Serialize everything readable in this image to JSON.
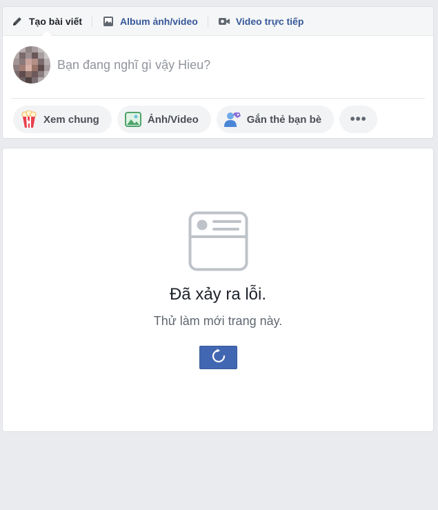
{
  "composer": {
    "tabs": [
      {
        "label": "Tạo bài viết",
        "icon": "pencil-icon"
      },
      {
        "label": "Album ảnh/video",
        "icon": "photo-album-icon"
      },
      {
        "label": "Video trực tiếp",
        "icon": "video-camera-icon"
      }
    ],
    "placeholder": "Bạn đang nghĩ gì vậy Hieu?",
    "actions": [
      {
        "label": "Xem chung",
        "icon": "popcorn-icon"
      },
      {
        "label": "Ảnh/Video",
        "icon": "photo-icon"
      },
      {
        "label": "Gắn thẻ bạn bè",
        "icon": "tag-friends-icon"
      },
      {
        "label": "•••",
        "icon": "more-icon"
      }
    ]
  },
  "error": {
    "title": "Đã xảy ra lỗi.",
    "subtitle": "Thử làm mới trang này.",
    "icon": "news-feed-placeholder-icon",
    "button_icon": "refresh-icon"
  },
  "colors": {
    "background": "#e9ebee",
    "link": "#365899",
    "button": "#4267b2"
  }
}
